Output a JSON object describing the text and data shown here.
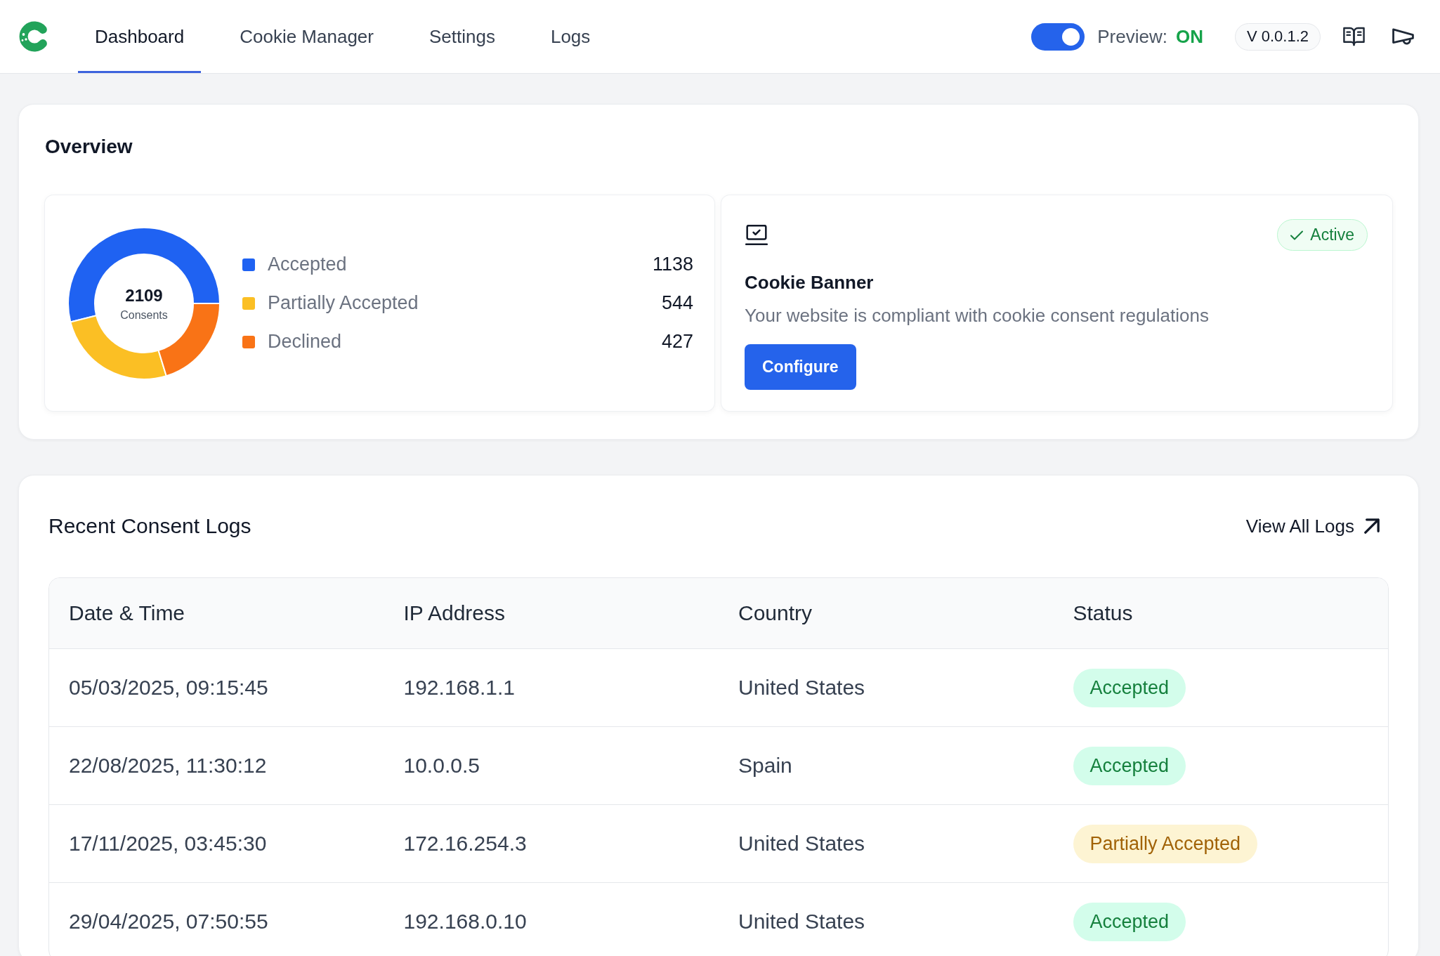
{
  "header": {
    "tabs": [
      {
        "label": "Dashboard",
        "selected": true
      },
      {
        "label": "Cookie Manager",
        "selected": false
      },
      {
        "label": "Settings",
        "selected": false
      },
      {
        "label": "Logs",
        "selected": false
      }
    ],
    "preview": {
      "label": "Preview:",
      "value": "ON",
      "on": true
    },
    "version": "V 0.0.1.2"
  },
  "overview": {
    "title": "Overview",
    "consents": {
      "total": "2109",
      "total_label": "Consents",
      "chart_data": {
        "type": "donut",
        "categories": [
          "Accepted",
          "Partially Accepted",
          "Declined"
        ],
        "values": [
          1138,
          544,
          427
        ],
        "value_labels": [
          "1138",
          "544",
          "427"
        ],
        "legend": "right"
      },
      "legend": [
        {
          "color": "#1f62f2"
        },
        {
          "color": "#fbbf24"
        },
        {
          "color": "#f97316"
        }
      ]
    },
    "cookie_banner": {
      "status": "Active",
      "title": "Cookie Banner",
      "description": "Your website is compliant with cookie consent regulations",
      "button": "Configure"
    }
  },
  "recent_logs": {
    "title": "Recent Consent Logs",
    "link": "View All Logs",
    "columns": [
      "Date & Time",
      "IP Address",
      "Country",
      "Status"
    ],
    "rows": [
      {
        "date_time": "05/03/2025, 09:15:45",
        "ip_address": "192.168.1.1",
        "country": "United States",
        "status": {
          "text": "Accepted",
          "color": "#15803d"
        }
      },
      {
        "date_time": "22/08/2025, 11:30:12",
        "ip_address": "10.0.0.5",
        "country": "Spain",
        "status": {
          "text": "Accepted",
          "color": "#15803d"
        }
      },
      {
        "date_time": "17/11/2025, 03:45:30",
        "ip_address": "172.16.254.3",
        "country": "United States",
        "status": {
          "text": "Partially Accepted",
          "color": "#a16207"
        }
      },
      {
        "date_time": "29/04/2025, 07:50:55",
        "ip_address": "192.168.0.10",
        "country": "United States",
        "status": {
          "text": "Accepted",
          "color": "#15803d"
        }
      }
    ]
  }
}
